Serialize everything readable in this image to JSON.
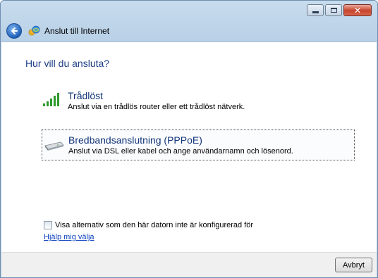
{
  "window": {
    "title": "Anslut till Internet",
    "controls": {
      "minimize": "–",
      "maximize": "□",
      "close": "✕"
    }
  },
  "main": {
    "heading": "Hur vill du ansluta?",
    "options": [
      {
        "title": "Trådlöst",
        "description": "Anslut via en trådlös router eller ett trådlöst nätverk.",
        "icon": "wireless-signal-icon"
      },
      {
        "title": "Bredbandsanslutning (PPPoE)",
        "description": "Anslut via DSL eller kabel och ange användarnamn och lösenord.",
        "icon": "modem-icon",
        "selected": true
      }
    ],
    "checkbox_label": "Visa alternativ som den här datorn inte är konfigurerad för",
    "checkbox_checked": false,
    "help_link": "Hjälp mig välja"
  },
  "footer": {
    "cancel_label": "Avbryt"
  },
  "colors": {
    "heading": "#1e3f87",
    "link": "#0a3fbf",
    "frame": "#b8d0e6"
  }
}
